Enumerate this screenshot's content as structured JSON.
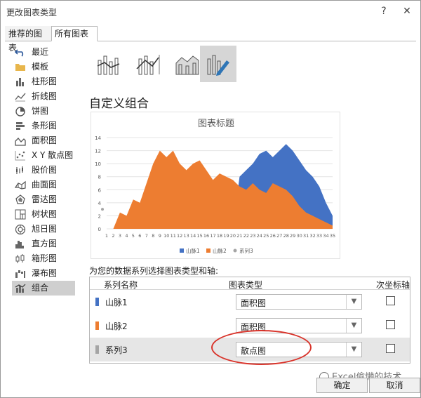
{
  "window": {
    "title": "更改图表类型",
    "help": "?",
    "close": "✕"
  },
  "tabs": [
    {
      "label": "推荐的图表"
    },
    {
      "label": "所有图表"
    }
  ],
  "nav": [
    {
      "label": "最近",
      "icon": "undo-icon"
    },
    {
      "label": "模板",
      "icon": "folder-icon"
    },
    {
      "label": "柱形图",
      "icon": "column-chart-icon"
    },
    {
      "label": "折线图",
      "icon": "line-chart-icon"
    },
    {
      "label": "饼图",
      "icon": "pie-chart-icon"
    },
    {
      "label": "条形图",
      "icon": "bar-chart-icon"
    },
    {
      "label": "面积图",
      "icon": "area-chart-icon"
    },
    {
      "label": "X Y 散点图",
      "icon": "scatter-chart-icon"
    },
    {
      "label": "股价图",
      "icon": "stock-chart-icon"
    },
    {
      "label": "曲面图",
      "icon": "surface-chart-icon"
    },
    {
      "label": "雷达图",
      "icon": "radar-chart-icon"
    },
    {
      "label": "树状图",
      "icon": "treemap-icon"
    },
    {
      "label": "旭日图",
      "icon": "sunburst-icon"
    },
    {
      "label": "直方图",
      "icon": "histogram-icon"
    },
    {
      "label": "箱形图",
      "icon": "box-whisker-icon"
    },
    {
      "label": "瀑布图",
      "icon": "waterfall-icon"
    },
    {
      "label": "组合",
      "icon": "combo-chart-icon"
    }
  ],
  "section_title": "自定义组合",
  "combo_label": "为您的数据系列选择图表类型和轴:",
  "table": {
    "col_series": "系列名称",
    "col_type": "图表类型",
    "col_axis": "次坐标轴",
    "rows": [
      {
        "name": "山脉1",
        "type": "面积图",
        "color": "#4472c4",
        "secondary": false
      },
      {
        "name": "山脉2",
        "type": "面积图",
        "color": "#ed7d31",
        "secondary": false
      },
      {
        "name": "系列3",
        "type": "散点图",
        "color": "#a5a5a5",
        "secondary": false
      }
    ]
  },
  "buttons": {
    "ok": "确定",
    "cancel": "取消"
  },
  "watermark": "Excel偷懒的技术",
  "chart_data": {
    "type": "area",
    "title": "图表标题",
    "categories": [
      "1",
      "2",
      "3",
      "4",
      "5",
      "6",
      "7",
      "8",
      "9",
      "10",
      "11",
      "12",
      "13",
      "14",
      "15",
      "16",
      "17",
      "18",
      "19",
      "20",
      "21",
      "22",
      "23",
      "24",
      "25",
      "26",
      "27",
      "28",
      "29",
      "30",
      "31",
      "32",
      "33",
      "34",
      "35"
    ],
    "ylim": [
      0,
      14
    ],
    "yticks": [
      "0",
      "2",
      "4",
      "6",
      "8",
      "10",
      "12",
      "14"
    ],
    "series": [
      {
        "name": "山脉1",
        "color": "#4472c4",
        "values": [
          0,
          0,
          0,
          0,
          0,
          0,
          0,
          0,
          0,
          0,
          0,
          0,
          0,
          0,
          0,
          0,
          0,
          0,
          0,
          0,
          8,
          9,
          10,
          11.5,
          12,
          11,
          12,
          13,
          12,
          10.5,
          9,
          8,
          6.5,
          4,
          2
        ]
      },
      {
        "name": "山脉2",
        "color": "#ed7d31",
        "values": [
          0,
          0,
          2.5,
          2,
          4.5,
          4,
          7,
          10,
          12,
          11,
          12,
          10,
          9,
          10,
          10.5,
          9,
          7.5,
          8.5,
          8,
          7.5,
          6.5,
          6,
          7,
          6,
          5.5,
          7,
          6.5,
          6,
          5,
          3.5,
          2.5,
          2,
          1.5,
          1,
          0.5
        ]
      },
      {
        "name": "系列3",
        "color": "#a5a5a5",
        "type": "scatter",
        "points": [
          {
            "x": 1,
            "y": 3
          }
        ]
      }
    ]
  }
}
